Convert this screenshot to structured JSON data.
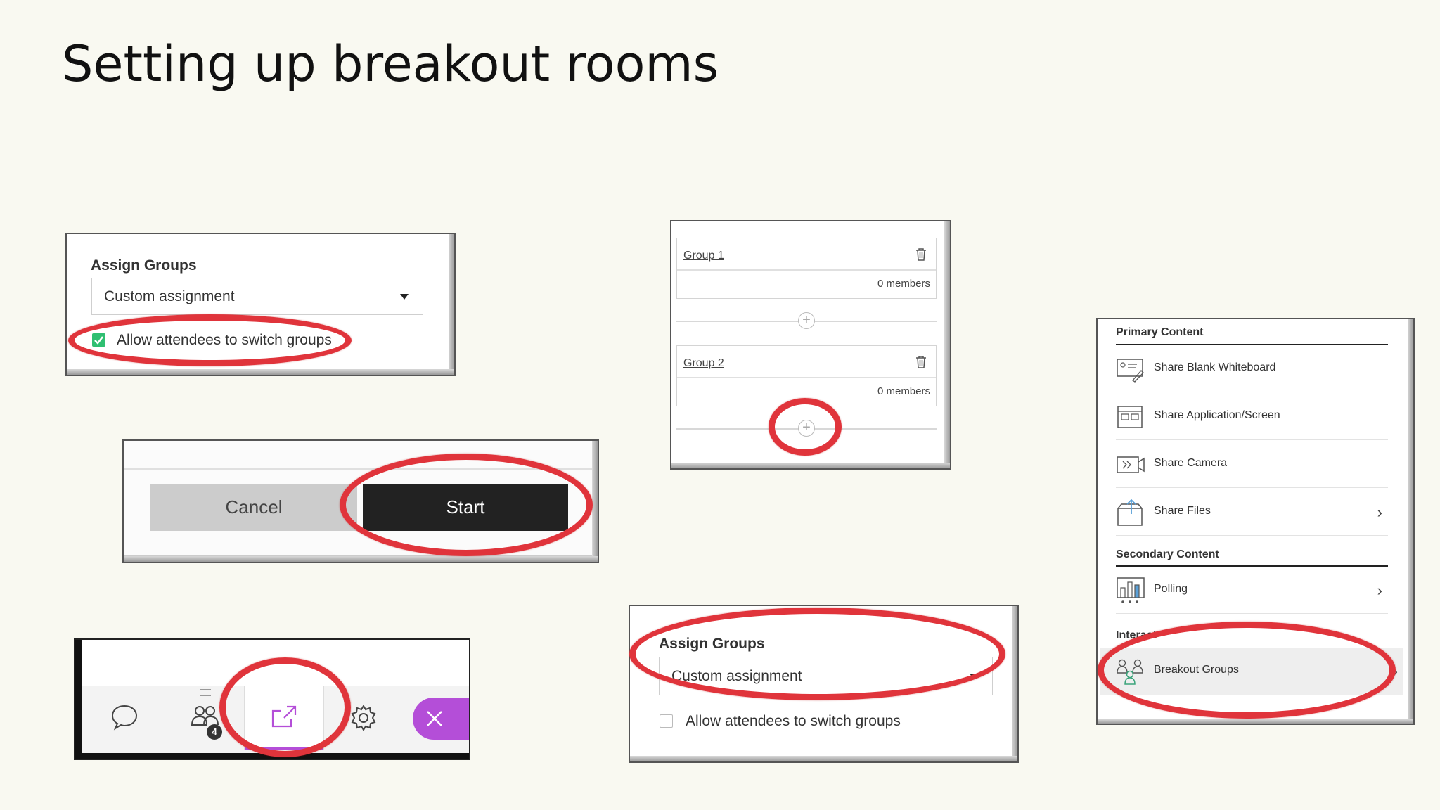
{
  "slide": {
    "title": "Setting up breakout rooms"
  },
  "panel_assign_top": {
    "heading": "Assign Groups",
    "select_value": "Custom assignment",
    "checkbox_label": "Allow attendees to switch groups",
    "checkbox_checked": true,
    "check_color": "#2fbf71"
  },
  "panel_buttons": {
    "cancel_label": "Cancel",
    "start_label": "Start"
  },
  "panel_groups": {
    "groups": [
      {
        "name": "Group 1",
        "members": "0 members"
      },
      {
        "name": "Group 2",
        "members": "0 members"
      }
    ]
  },
  "panel_toolbar": {
    "icons": [
      "chat-icon",
      "attendees-icon",
      "share-content-icon",
      "settings-icon",
      "close-icon"
    ],
    "badge": "4",
    "accent": "#b44ed8"
  },
  "panel_assign_bottom": {
    "heading": "Assign Groups",
    "select_value": "Custom assignment",
    "checkbox_label": "Allow attendees to switch groups",
    "checkbox_checked": false
  },
  "panel_menu": {
    "primary_heading": "Primary Content",
    "primary_items": [
      {
        "label": "Share Blank Whiteboard",
        "icon": "whiteboard-icon"
      },
      {
        "label": "Share Application/Screen",
        "icon": "screen-icon"
      },
      {
        "label": "Share Camera",
        "icon": "camera-icon"
      },
      {
        "label": "Share Files",
        "icon": "files-icon"
      }
    ],
    "secondary_heading": "Secondary Content",
    "secondary_items": [
      {
        "label": "Polling",
        "icon": "polling-icon"
      }
    ],
    "interact_heading": "Interact",
    "interact_items": [
      {
        "label": "Breakout Groups",
        "icon": "breakout-groups-icon"
      }
    ]
  },
  "colors": {
    "highlight_ring": "#e0343b",
    "start_button": "#222222",
    "cancel_button": "#cccccc"
  }
}
